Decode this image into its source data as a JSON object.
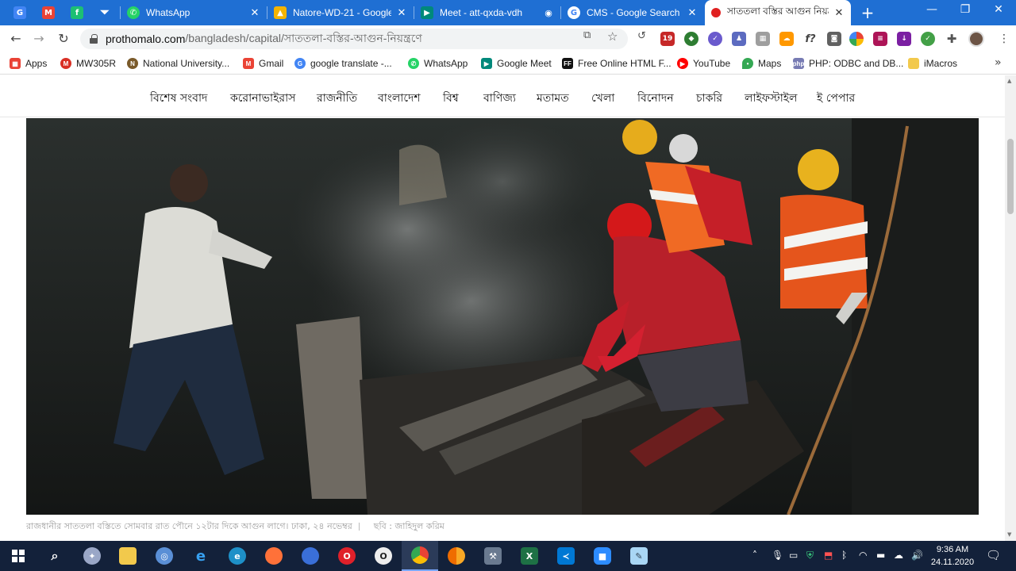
{
  "browser": {
    "tabs": [
      {
        "title": "WhatsApp",
        "favicon": "whatsapp-icon",
        "color": "#25d366"
      },
      {
        "title": "Natore-WD-21 - Google",
        "favicon": "google-drive-icon",
        "color": "#f4b400"
      },
      {
        "title": "Meet - att-qxda-vdh",
        "favicon": "google-meet-icon",
        "color": "#00897b"
      },
      {
        "title": "CMS - Google Search",
        "favicon": "google-icon",
        "color": "#4285f4"
      },
      {
        "title": "সাততলা বস্তির আগুন নিয়ন্ত্রণে",
        "favicon": "prothomalo-icon",
        "color": "#e02020"
      }
    ],
    "url_host": "prothomalo.com",
    "url_path": "/bangladesh/capital/সাততলা-বস্তির-আগুন-নিয়ন্ত্রণে",
    "close_glyph": "✕",
    "new_tab_glyph": "+",
    "window_controls": {
      "minimize": "—",
      "restore": "❐",
      "close": "✕"
    },
    "extension_badge": "19"
  },
  "bookmarks": [
    {
      "label": "Apps",
      "icon": "apps-grid-icon",
      "color": "#e94235"
    },
    {
      "label": "MW305R",
      "icon": "mercusys-icon",
      "color": "#d93025"
    },
    {
      "label": "National University...",
      "icon": "nu-logo-icon",
      "color": "#7a5a2a"
    },
    {
      "label": "Gmail",
      "icon": "gmail-icon",
      "color": "#ea4335"
    },
    {
      "label": "google translate -...",
      "icon": "google-icon",
      "color": "#4285f4"
    },
    {
      "label": "WhatsApp",
      "icon": "whatsapp-icon",
      "color": "#25d366"
    },
    {
      "label": "Google Meet",
      "icon": "google-meet-icon",
      "color": "#00897b"
    },
    {
      "label": "Free Online HTML F...",
      "icon": "ff-icon",
      "color": "#111111"
    },
    {
      "label": "YouTube",
      "icon": "youtube-icon",
      "color": "#ff0000"
    },
    {
      "label": "Maps",
      "icon": "maps-pin-icon",
      "color": "#34a853"
    },
    {
      "label": "PHP: ODBC and DB...",
      "icon": "php-icon",
      "color": "#777bb3"
    },
    {
      "label": "iMacros",
      "icon": "folder-icon",
      "color": "#f2c94c"
    }
  ],
  "site_nav": [
    "বিশেষ সংবাদ",
    "করোনাভাইরাস",
    "রাজনীতি",
    "বাংলাদেশ",
    "বিশ্ব",
    "বাণিজ্য",
    "মতামত",
    "খেলা",
    "বিনোদন",
    "চাকরি",
    "লাইফস্টাইল",
    "ই পেপার"
  ],
  "article": {
    "caption": "রাজধানীর সাততলা বস্তিতে সোমবার রাত পৌনে ১২টার দিকে আগুন লাগে। ঢাকা, ২৪ নভেম্বর",
    "credit": "ছবি : জাহিদুল করিম"
  },
  "taskbar": {
    "apps": [
      "start-icon",
      "search-icon",
      "stardict-icon",
      "file-explorer-icon",
      "network-icon",
      "internet-explorer-icon",
      "edge-icon",
      "firefox-icon",
      "firefox-dev-icon",
      "opera-icon",
      "opera-gx-icon",
      "chrome-icon",
      "chrome-canary-icon",
      "tools-icon",
      "excel-icon",
      "vscode-icon",
      "zoom-icon",
      "notepad-icon"
    ],
    "time": "9:36 AM",
    "date": "24.11.2020"
  }
}
